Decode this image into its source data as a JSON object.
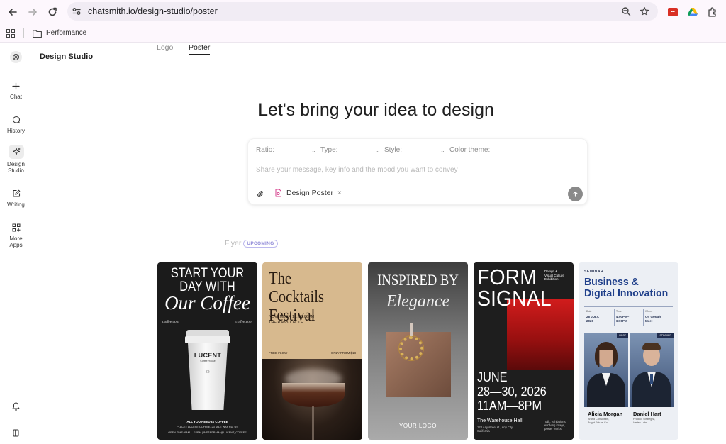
{
  "browser": {
    "url": "chatsmith.io/design-studio/poster",
    "bookmark_folder": "Performance"
  },
  "app": {
    "title": "Design Studio",
    "sidebar": [
      {
        "label": "Chat",
        "icon": "plus-icon"
      },
      {
        "label": "History",
        "icon": "chat-bubble-icon"
      },
      {
        "label": "Design Studio",
        "line1": "Design",
        "line2": "Studio",
        "icon": "sparkle-icon"
      },
      {
        "label": "Writing",
        "icon": "edit-icon"
      },
      {
        "label": "More Apps",
        "line1": "More",
        "line2": "Apps",
        "icon": "apps-icon"
      }
    ],
    "heading": "Let's bring your idea to design",
    "composer": {
      "selectors": [
        "Ratio:",
        "Type:",
        "Style:",
        "Color theme:"
      ],
      "placeholder": "Share your message, key info and the mood you want to convey",
      "chip": "Design Poster"
    },
    "tabs": [
      {
        "label": "Logo",
        "state": "default"
      },
      {
        "label": "Poster",
        "state": "active"
      },
      {
        "label": "Flyer",
        "state": "disabled",
        "badge": "UPCOMING"
      }
    ],
    "posters": [
      {
        "name": "coffee",
        "line1": "START YOUR",
        "line2": "DAY WITH",
        "line3": "Our Coffee",
        "site_left": "coffee.com",
        "site_right": "coffee.com",
        "cup_brand": "LUCENT",
        "cup_sub": "Coffee House",
        "footer1": "ALL YOU NEED IS COFFEE",
        "footer2": "PLACE : LUCENT COFFEE, 23 MILE WAY RD, US",
        "footer3": "OPEN TIME: 6AM — 10PM | INSTAGRAM: @LUCENT_COFFEE"
      },
      {
        "name": "cocktails",
        "line1": "The Cocktails",
        "line2": "Festival",
        "date": "NOVEMBER 15, 08:00PM",
        "venue": "THE RABBIT HOLE",
        "left": "FREE FLOW",
        "right": "ONLY FROM $18"
      },
      {
        "name": "elegance",
        "line1": "INSPIRED BY",
        "line2": "Elegance",
        "logo": "YOUR LOGO"
      },
      {
        "name": "form-signal",
        "line1": "FORM",
        "line2": "SIGNAL",
        "side1": "Design &",
        "side2": "Visual Culture",
        "side3": "Exhibition",
        "date1": "JUNE",
        "date2": "28—30, 2026",
        "time": "11AM—8PM",
        "venue": "The Warehouse Hall",
        "addr1": "123 Any street st., Any City,",
        "addr2": "California",
        "note1": "Talk, exhibitions,",
        "note2": "evolving image,",
        "note3": "poster works"
      },
      {
        "name": "business",
        "tag": "SEMINAR",
        "line1": "Business &",
        "line2": "Digital Innovation",
        "date_label": "Date",
        "date1": "28 JULY,",
        "date2": "2026",
        "time_label": "Time",
        "time1": "4:00PM–",
        "time2": "6:00PM",
        "where_label": "Where",
        "where1": "On Google",
        "where2": "Meet",
        "host_tag": "HOST",
        "speaker_tag": "SPEAKER",
        "person1": "Alicia Morgan",
        "role1": "Brand Consultant,",
        "org1": "Bright Future Co.",
        "person2": "Daniel Hart",
        "role2": "Product Strategist,",
        "org2": "Vertex Labs"
      }
    ]
  }
}
